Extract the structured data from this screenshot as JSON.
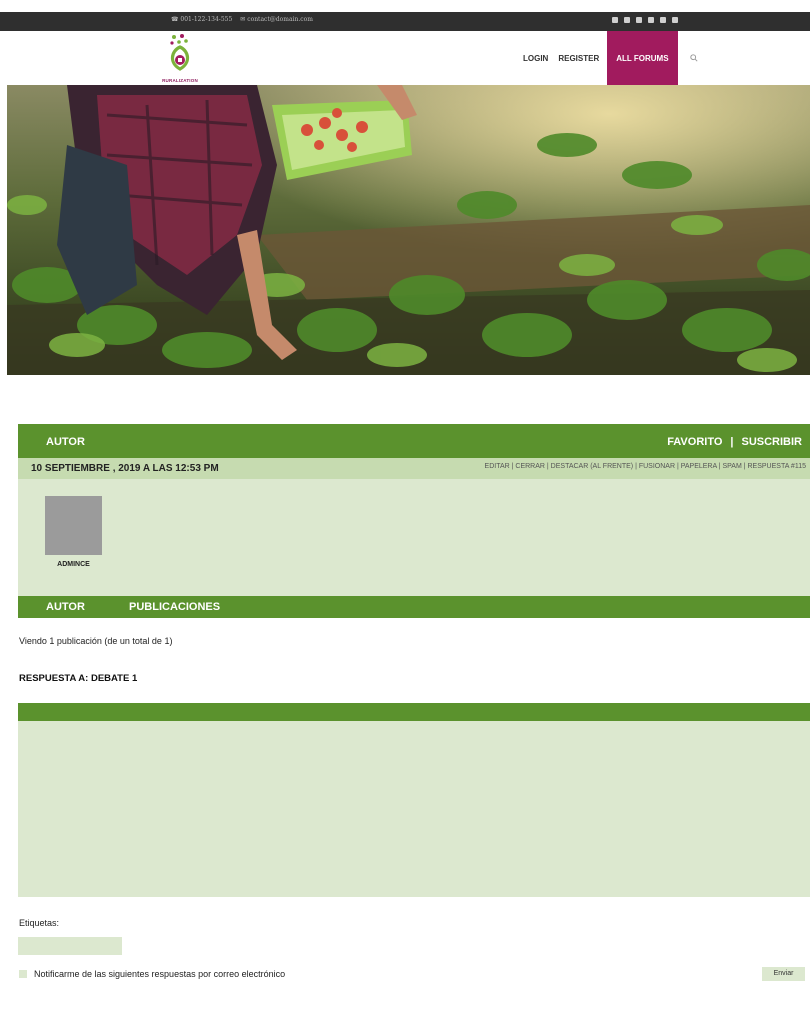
{
  "topbar": {
    "phone": "☎ 001-122-134-555",
    "email": "✉ contact@domain.com",
    "social_icons": [
      "twitter-icon",
      "instagram-icon",
      "facebook-icon",
      "pinterest-icon",
      "youtube-icon",
      "rss-icon"
    ]
  },
  "header": {
    "logo_text": "RURALIZATION",
    "nav": {
      "login": "LOGIN",
      "register": "REGISTER",
      "all_forums": "ALL FORUMS"
    },
    "search_icon": "search-icon"
  },
  "forum": {
    "header": {
      "autor": "AUTOR",
      "favorito": "FAVORITO",
      "separator": "|",
      "suscribir": "SUSCRIBIR"
    },
    "post": {
      "date": "10 SEPTIEMBRE , 2019 A LAS 12:53 PM",
      "admin_links": "EDITAR | CERRAR | DESTACAR (AL FRENTE) | FUSIONAR | PAPELERA | SPAM | RESPUESTA  #115",
      "author": "ADMINCE"
    },
    "footer": {
      "autor": "AUTOR",
      "publicaciones": "PUBLICACIONES"
    },
    "viewing": "Viendo 1 publicación (de un total de 1)"
  },
  "reply": {
    "title": "RESPUESTA A: DEBATE 1",
    "tags_label": "Etiquetas:",
    "notify_label": "Notificarme de las siguientes respuestas por correo electrónico",
    "submit": "Enviar"
  },
  "colors": {
    "green": "#5b922d",
    "light_green": "#dce8cf",
    "magenta": "#a11b5e",
    "topbar": "#2f2f2f"
  }
}
